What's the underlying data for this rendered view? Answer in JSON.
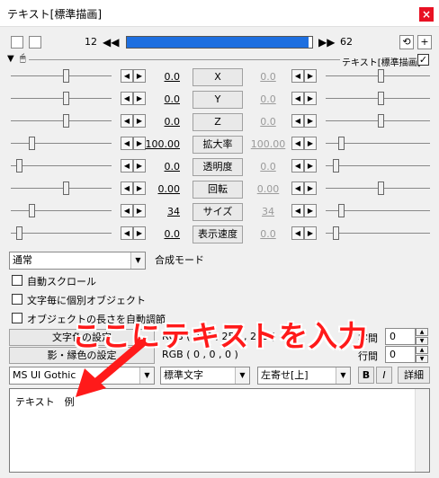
{
  "window": {
    "title": "テキスト[標準描画]",
    "close_glyph": "×"
  },
  "timeline": {
    "start_frame": "12",
    "end_frame": "62",
    "prev_glyph": "◀◀",
    "next_glyph": "▶▶",
    "progress": 0.98
  },
  "object_header": {
    "label": "テキスト[標準描画]",
    "checked": "✓"
  },
  "params": [
    {
      "name": "X",
      "left_value": "0.0",
      "right_value": "0.0"
    },
    {
      "name": "Y",
      "left_value": "0.0",
      "right_value": "0.0"
    },
    {
      "name": "Z",
      "left_value": "0.0",
      "right_value": "0.0"
    },
    {
      "name": "拡大率",
      "left_value": "100.00",
      "right_value": "100.00"
    },
    {
      "name": "透明度",
      "left_value": "0.0",
      "right_value": "0.0"
    },
    {
      "name": "回転",
      "left_value": "0.00",
      "right_value": "0.00"
    },
    {
      "name": "サイズ",
      "left_value": "34",
      "right_value": "34"
    },
    {
      "name": "表示速度",
      "left_value": "0.0",
      "right_value": "0.0"
    }
  ],
  "blend": {
    "selected": "通常",
    "label": "合成モード"
  },
  "checkboxes": [
    "自動スクロール",
    "文字毎に個別オブジェクト",
    "オブジェクトの長さを自動調節"
  ],
  "buttons": {
    "text_color": "文字色の設定",
    "shadow_color": "影・縁色の設定",
    "bold": "B",
    "italic": "I",
    "details": "詳細"
  },
  "color_values": {
    "text_rgb": "RGB ( 255 , 255 , 255 )",
    "shadow_rgb": "RGB ( 0 , 0 , 0 )"
  },
  "spacing": {
    "char_label": "字間",
    "char_value": "0",
    "line_label": "行間",
    "line_value": "0"
  },
  "font": {
    "family": "MS UI Gothic",
    "style": "標準文字",
    "align": "左寄せ[上]"
  },
  "text_content": "テキスト　例",
  "annotation": "ここにテキストを入力"
}
